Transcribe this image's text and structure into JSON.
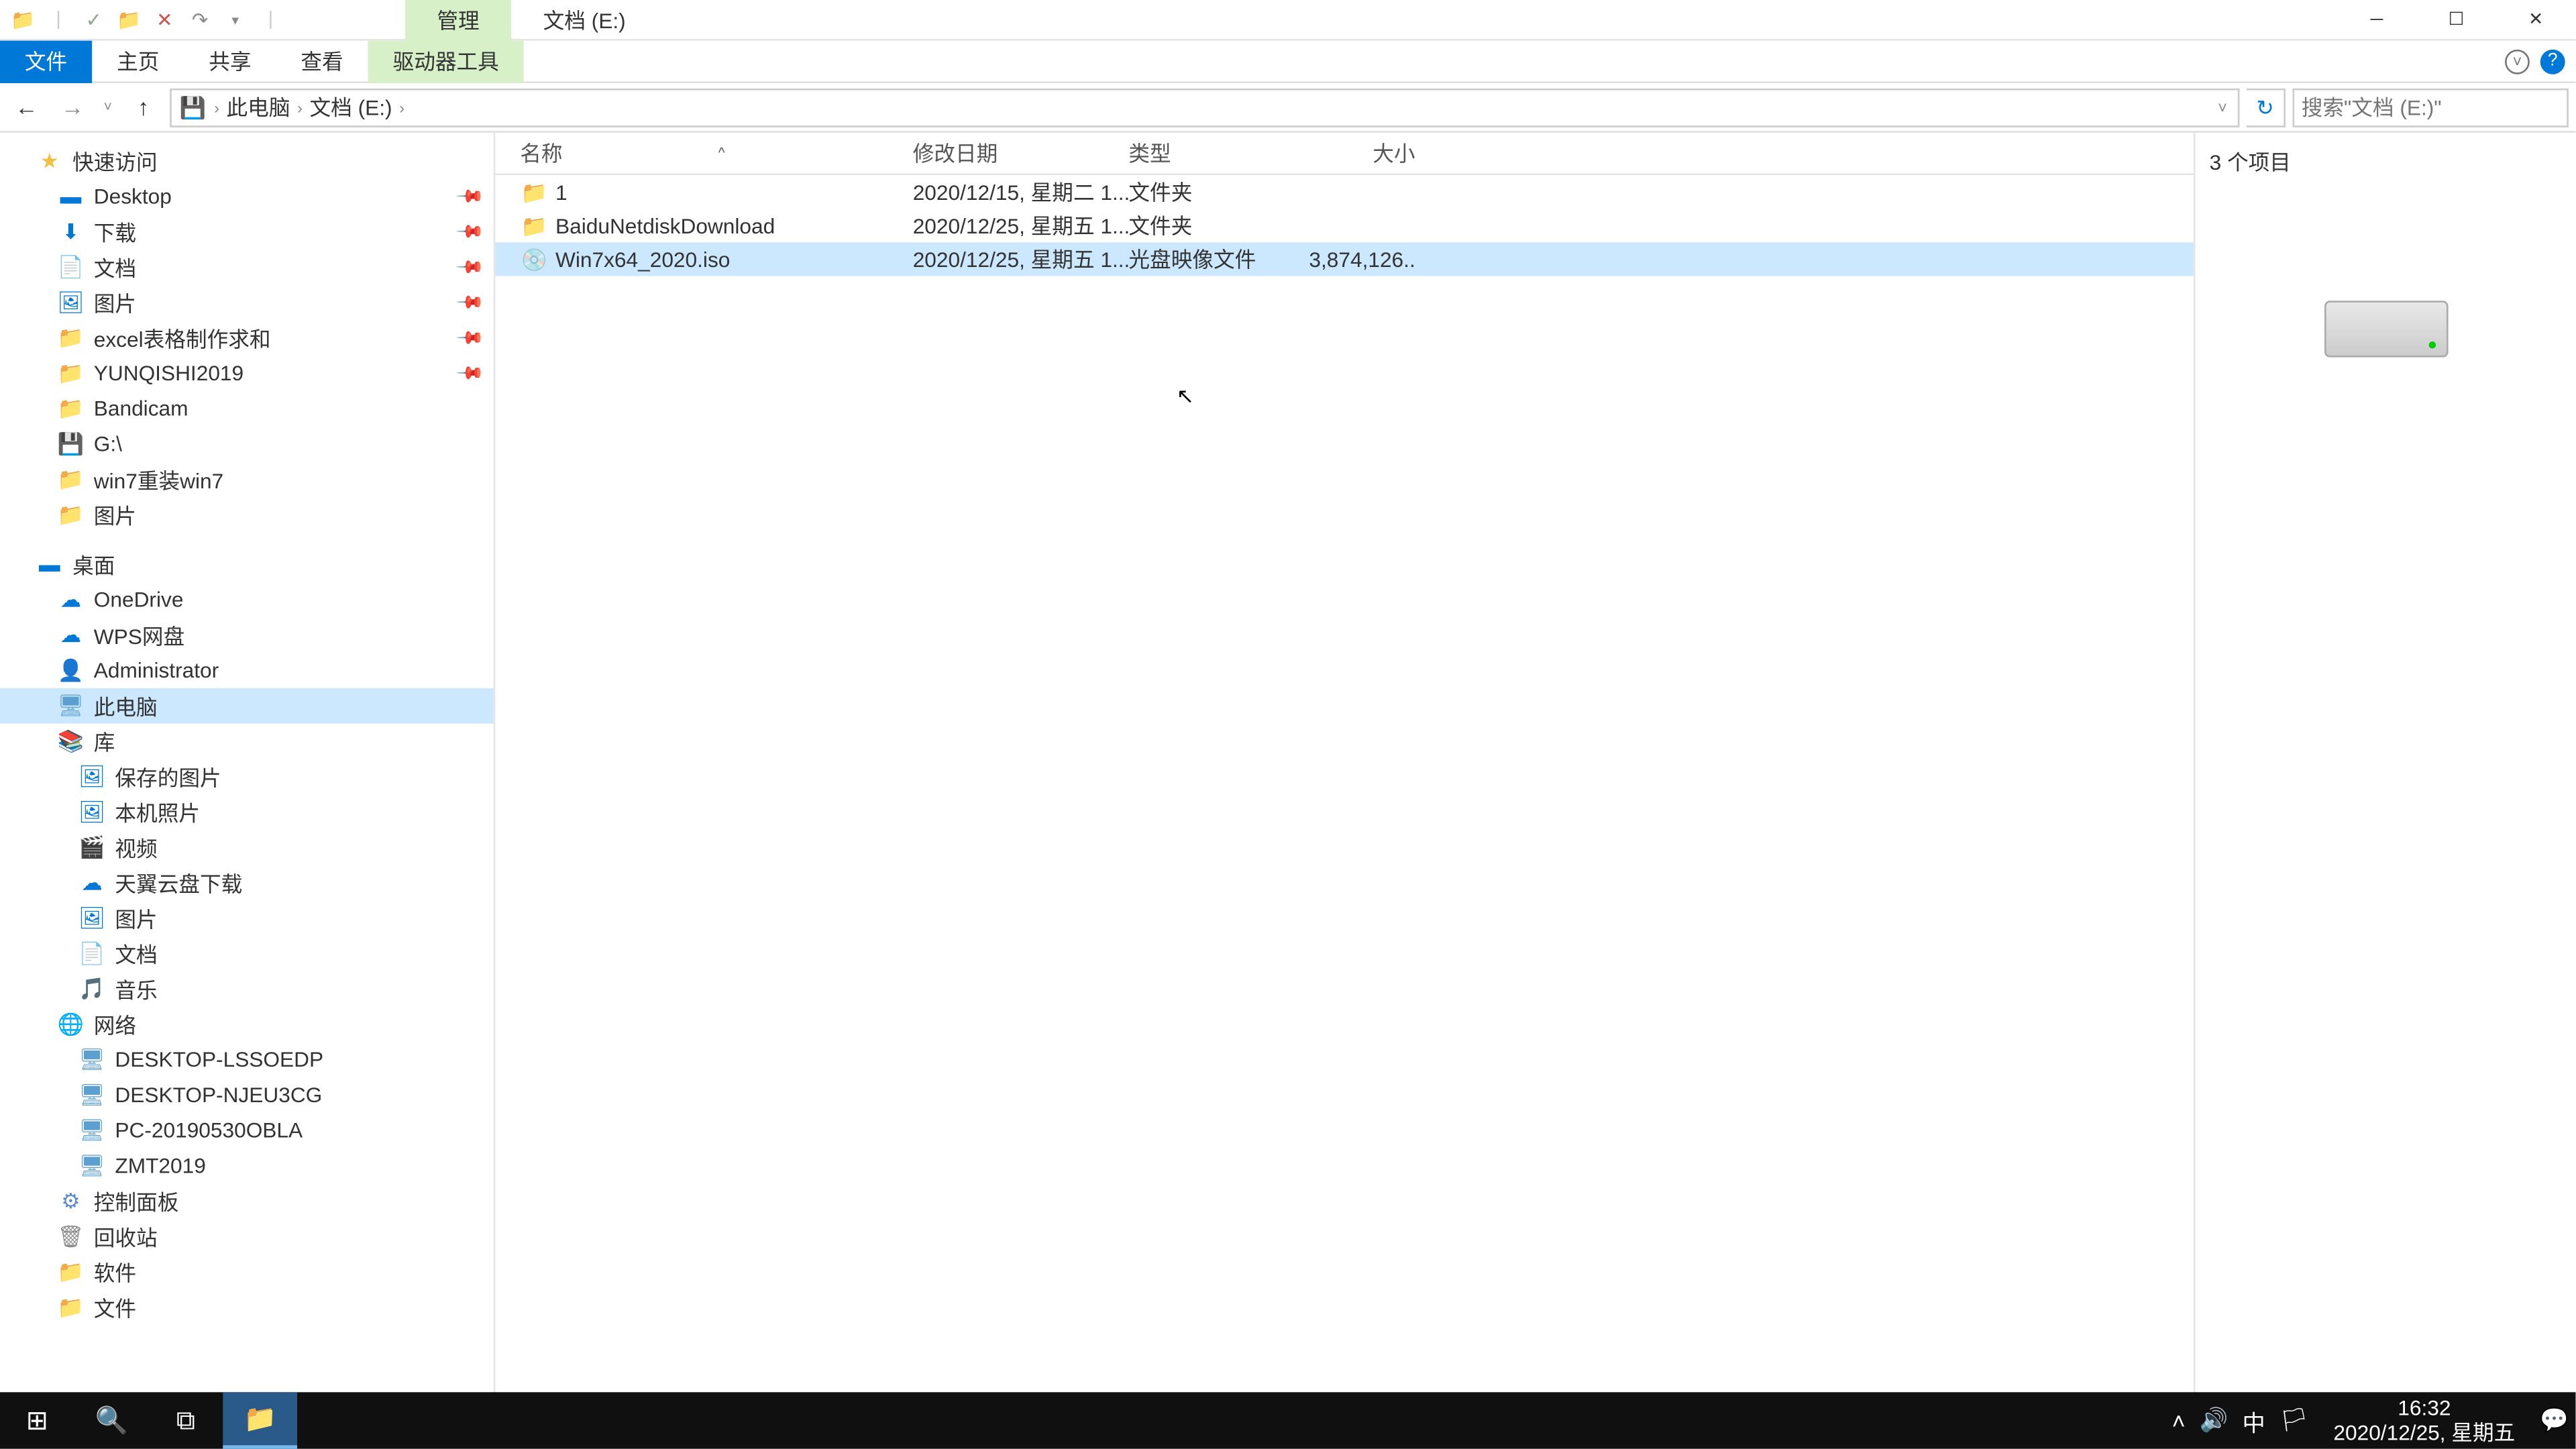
{
  "title": {
    "contextual": "管理",
    "location": "文档 (E:)"
  },
  "ribbon": {
    "file": "文件",
    "home": "主页",
    "share": "共享",
    "view": "查看",
    "drive_tools": "驱动器工具"
  },
  "breadcrumb": {
    "pc": "此电脑",
    "loc": "文档 (E:)"
  },
  "search": {
    "placeholder": "搜索\"文档 (E:)\""
  },
  "columns": {
    "name": "名称",
    "date": "修改日期",
    "type": "类型",
    "size": "大小"
  },
  "files": [
    {
      "name": "1",
      "date": "2020/12/15, 星期二 1...",
      "type": "文件夹",
      "size": "",
      "icon": "folder"
    },
    {
      "name": "BaiduNetdiskDownload",
      "date": "2020/12/25, 星期五 1...",
      "type": "文件夹",
      "size": "",
      "icon": "folder"
    },
    {
      "name": "Win7x64_2020.iso",
      "date": "2020/12/25, 星期五 1...",
      "type": "光盘映像文件",
      "size": "3,874,126...",
      "icon": "iso"
    }
  ],
  "nav": {
    "quick": "快速访问",
    "quick_items": [
      "Desktop",
      "下载",
      "文档",
      "图片",
      "excel表格制作求和",
      "YUNQISHI2019",
      "Bandicam",
      "G:\\",
      "win7重装win7",
      "图片"
    ],
    "desktop": "桌面",
    "desktop_items": [
      "OneDrive",
      "WPS网盘",
      "Administrator",
      "此电脑",
      "库"
    ],
    "lib_items": [
      "保存的图片",
      "本机照片",
      "视频",
      "天翼云盘下载",
      "图片",
      "文档",
      "音乐"
    ],
    "network": "网络",
    "net_items": [
      "DESKTOP-LSSOEDP",
      "DESKTOP-NJEU3CG",
      "PC-20190530OBLA",
      "ZMT2019"
    ],
    "cp": "控制面板",
    "recycle": "回收站",
    "soft": "软件",
    "files": "文件"
  },
  "preview": {
    "count": "3 个项目"
  },
  "status": {
    "items": "3 个项目"
  },
  "tray": {
    "ime": "中",
    "time": "16:32",
    "date": "2020/12/25, 星期五"
  }
}
